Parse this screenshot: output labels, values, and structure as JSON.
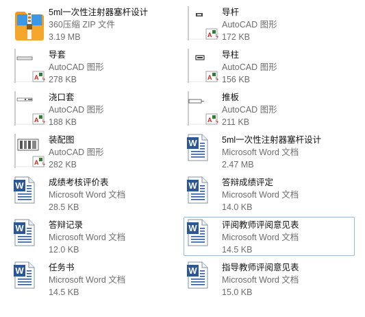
{
  "files": [
    {
      "name": "5ml一次性注射器塞杆设计",
      "type": "360压缩 ZIP 文件",
      "size": "3.19 MB",
      "icon": "zip-archive-icon"
    },
    {
      "name": "导杆",
      "type": "AutoCAD 图形",
      "size": "172 KB",
      "icon": "autocad-drawing-icon"
    },
    {
      "name": "导套",
      "type": "AutoCAD 图形",
      "size": "278 KB",
      "icon": "autocad-drawing-icon"
    },
    {
      "name": "导柱",
      "type": "AutoCAD 图形",
      "size": "156 KB",
      "icon": "autocad-drawing-icon"
    },
    {
      "name": "浇口套",
      "type": "AutoCAD 图形",
      "size": "188 KB",
      "icon": "autocad-drawing-icon"
    },
    {
      "name": "推板",
      "type": "AutoCAD 图形",
      "size": "211 KB",
      "icon": "autocad-drawing-icon"
    },
    {
      "name": "装配图",
      "type": "AutoCAD 图形",
      "size": "282 KB",
      "icon": "autocad-drawing-icon"
    },
    {
      "name": "5ml一次性注射器塞杆设计",
      "type": "Microsoft Word 文档",
      "size": "2.47 MB",
      "icon": "word-document-icon"
    },
    {
      "name": "成绩考核评价表",
      "type": "Microsoft Word 文档",
      "size": "28.5 KB",
      "icon": "word-document-icon"
    },
    {
      "name": "答辩成绩评定",
      "type": "Microsoft Word 文档",
      "size": "14.0 KB",
      "icon": "word-document-icon"
    },
    {
      "name": "答辩记录",
      "type": "Microsoft Word 文档",
      "size": "12.0 KB",
      "icon": "word-document-icon"
    },
    {
      "name": "评阅教师评阅意见表",
      "type": "Microsoft Word 文档",
      "size": "14.5 KB",
      "icon": "word-document-icon",
      "selected": true
    },
    {
      "name": "任务书",
      "type": "Microsoft Word 文档",
      "size": "14.5 KB",
      "icon": "word-document-icon"
    },
    {
      "name": "指导教师评阅意见表",
      "type": "Microsoft Word 文档",
      "size": "15.0 KB",
      "icon": "word-document-icon"
    }
  ],
  "colors": {
    "word_blue": "#2b5797",
    "cad_red": "#c9271a",
    "selection_border": "#9bb6d6",
    "zip_orange": "#f29a1d",
    "zip_blue": "#2c8fe3"
  }
}
